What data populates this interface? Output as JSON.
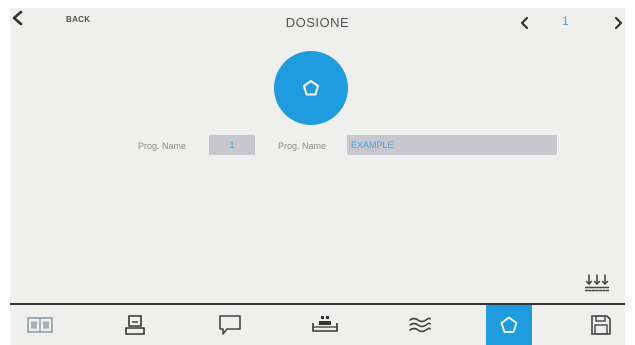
{
  "header": {
    "back_label": "BACK",
    "title": "DOSIONE",
    "page_number": "1"
  },
  "form": {
    "prog_label_1": "Prog. Name",
    "prog_number": "1",
    "prog_label_2": "Prog. Name",
    "prog_name": "EXAMPLE"
  },
  "toolbar": {
    "items": [
      {
        "icon": "book-icon"
      },
      {
        "icon": "scale-icon"
      },
      {
        "icon": "chat-icon"
      },
      {
        "icon": "bed-icon"
      },
      {
        "icon": "waves-icon"
      },
      {
        "icon": "pentagon-icon",
        "active": true
      },
      {
        "icon": "save-icon"
      }
    ]
  },
  "colors": {
    "accent": "#1f9ce0",
    "background": "#efefed",
    "field_bg": "#c6c7cf",
    "field_text": "#3fa7df"
  }
}
